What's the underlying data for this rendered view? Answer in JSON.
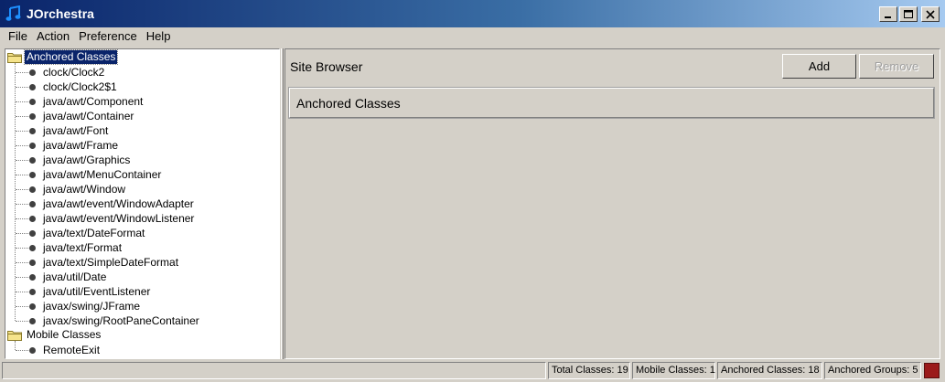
{
  "window": {
    "title": "JOrchestra"
  },
  "menu": [
    "File",
    "Action",
    "Preference",
    "Help"
  ],
  "tree": {
    "folders": [
      {
        "label": "Anchored Classes",
        "selected": true,
        "items": [
          "clock/Clock2",
          "clock/Clock2$1",
          "java/awt/Component",
          "java/awt/Container",
          "java/awt/Font",
          "java/awt/Frame",
          "java/awt/Graphics",
          "java/awt/MenuContainer",
          "java/awt/Window",
          "java/awt/event/WindowAdapter",
          "java/awt/event/WindowListener",
          "java/text/DateFormat",
          "java/text/Format",
          "java/text/SimpleDateFormat",
          "java/util/Date",
          "java/util/EventListener",
          "javax/swing/JFrame",
          "javax/swing/RootPaneContainer"
        ]
      },
      {
        "label": "Mobile Classes",
        "selected": false,
        "items": [
          "RemoteExit"
        ]
      }
    ]
  },
  "site_browser": {
    "label": "Site Browser",
    "add_label": "Add",
    "remove_label": "Remove",
    "group_label": "Anchored Classes"
  },
  "status": {
    "total": "Total Classes: 19",
    "mobile": "Mobile Classes: 1",
    "anchored": "Anchored Classes: 18",
    "groups": "Anchored Groups: 5",
    "indicator_color": "#9b1b1b"
  },
  "colors": {
    "selection": "#0a246a",
    "face": "#d4d0c8"
  }
}
